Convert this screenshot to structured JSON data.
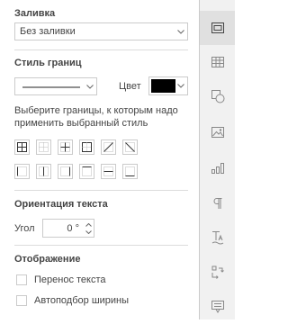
{
  "fill": {
    "heading": "Заливка",
    "value": "Без заливки"
  },
  "border_style": {
    "heading": "Стиль границ",
    "color_label": "Цвет",
    "color_value": "#000000",
    "hint_line1": "Выберите границы, к которым надо",
    "hint_line2": "применить выбранный стиль",
    "buttons_row1": [
      "all-borders",
      "inner-borders",
      "inner-cross",
      "outer-borders",
      "diagonal-up",
      "diagonal-down"
    ],
    "buttons_row2": [
      "left-border",
      "vertical-inner",
      "right-border",
      "top-border",
      "horizontal-inner",
      "bottom-border"
    ]
  },
  "text_orientation": {
    "heading": "Ориентация текста",
    "angle_label": "Угол",
    "angle_value": "0 °"
  },
  "display": {
    "heading": "Отображение",
    "wrap_label": "Перенос текста",
    "wrap_checked": false,
    "autofit_label": "Автоподбор ширины",
    "autofit_checked": false
  },
  "sidebar": {
    "items": [
      "cell-settings-icon",
      "table-icon",
      "shape-icon",
      "image-icon",
      "chart-icon",
      "paragraph-icon",
      "text-art-icon",
      "pivot-icon",
      "signature-icon"
    ],
    "active": "cell-settings-icon"
  }
}
